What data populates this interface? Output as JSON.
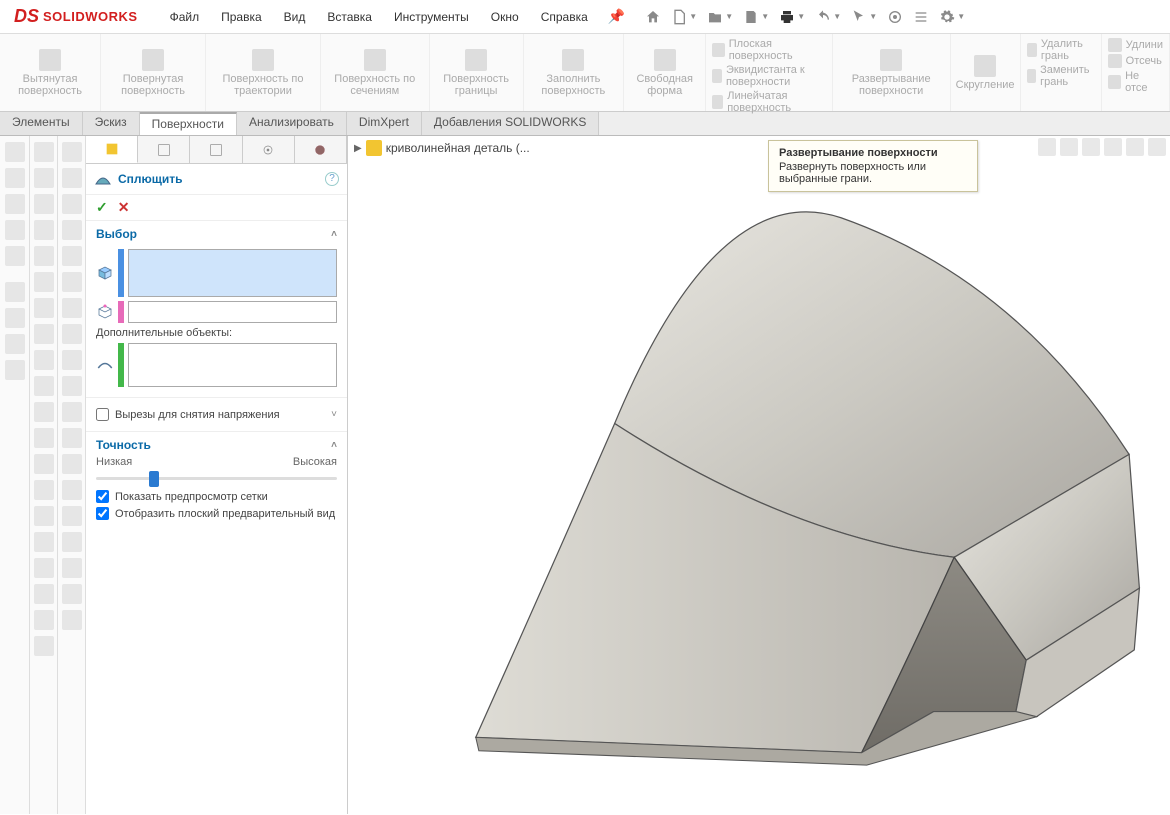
{
  "app": {
    "brand": "SOLIDWORKS"
  },
  "menu": [
    "Файл",
    "Правка",
    "Вид",
    "Вставка",
    "Инструменты",
    "Окно",
    "Справка"
  ],
  "ribbon": {
    "big": [
      "Вытянутая поверхность",
      "Повернутая поверхность",
      "Поверхность по траектории",
      "Поверхность по сечениям",
      "Поверхность границы",
      "Заполнить поверхность",
      "Свободная форма"
    ],
    "stack1": [
      "Плоская поверхность",
      "Эквидистанта к поверхности",
      "Линейчатая поверхность"
    ],
    "mid": [
      "Развертывание поверхности"
    ],
    "mid2": [
      "Скругление"
    ],
    "stack2": [
      "Удалить грань",
      "Заменить грань"
    ],
    "stack3": [
      "Удлини",
      "Отсечь",
      "Не отсе"
    ]
  },
  "tabs": [
    "Элементы",
    "Эскиз",
    "Поверхности",
    "Анализировать",
    "DimXpert",
    "Добавления SOLIDWORKS"
  ],
  "tabs_active": 2,
  "fm": {
    "title": "Сплющить",
    "sec_select": "Выбор",
    "extra_label": "Дополнительные объекты:",
    "relief": "Вырезы для снятия напряжения",
    "accuracy": "Точность",
    "low": "Низкая",
    "high": "Высокая",
    "preview": "Показать предпросмотр сетки",
    "flat": "Отобразить плоский предварительный вид"
  },
  "breadcrumb": "криволинейная деталь  (...",
  "tooltip": {
    "title": "Развертывание поверхности",
    "body": "Развернуть поверхность или выбранные грани."
  }
}
